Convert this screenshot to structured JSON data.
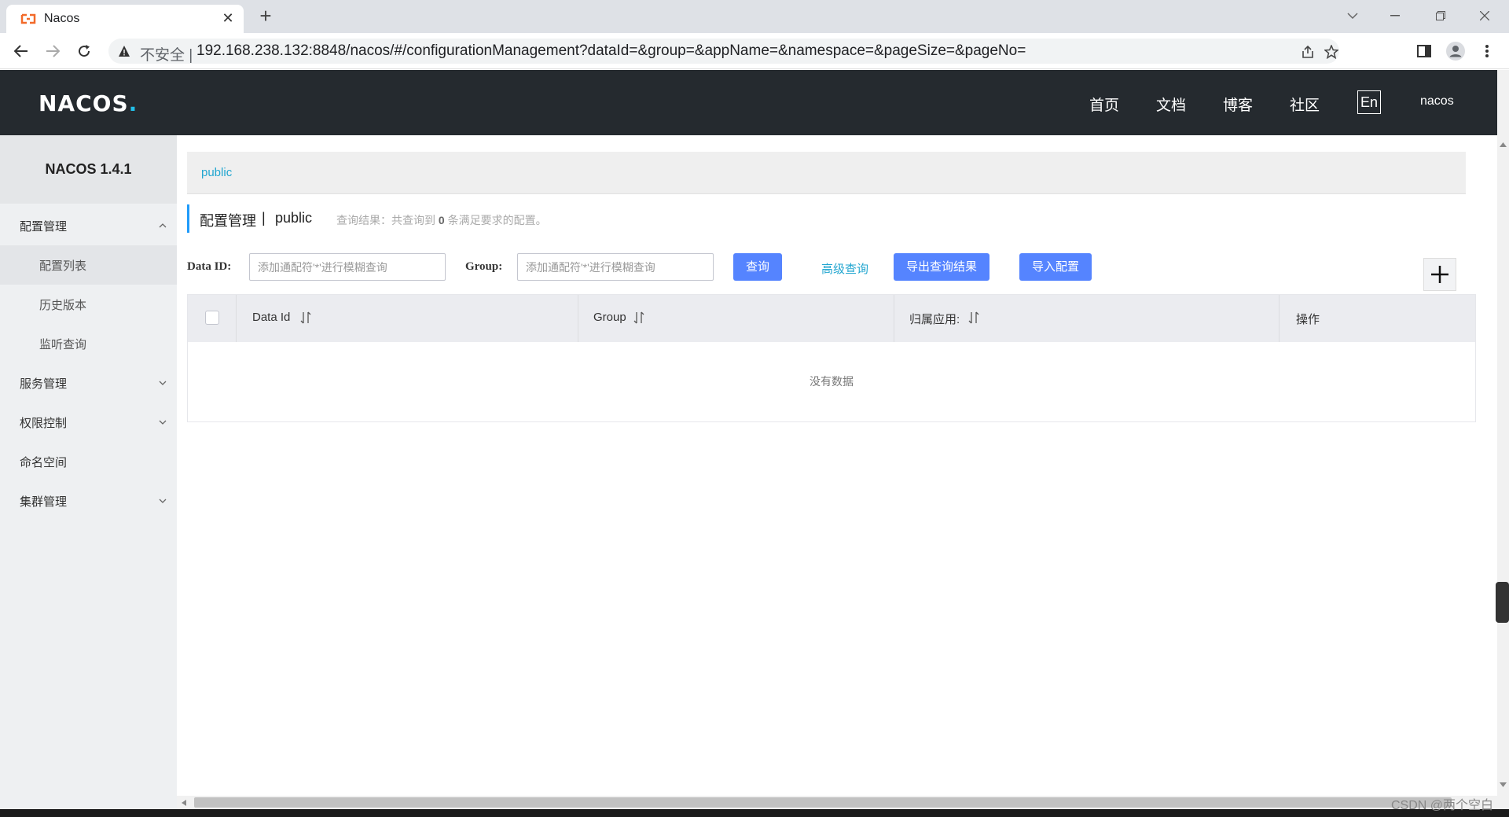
{
  "browser": {
    "tab_title": "Nacos",
    "security_label": "不安全 |",
    "url": "192.168.238.132:8848/nacos/#/configurationManagement?dataId=&group=&appName=&namespace=&pageSize=&pageNo="
  },
  "header": {
    "logo": "NACOS",
    "logo_dot": ".",
    "nav": [
      "首页",
      "文档",
      "博客",
      "社区"
    ],
    "lang": "En",
    "user": "nacos"
  },
  "sidebar": {
    "title": "NACOS 1.4.1",
    "items": [
      {
        "label": "配置管理"
      },
      {
        "label": "配置列表"
      },
      {
        "label": "历史版本"
      },
      {
        "label": "监听查询"
      },
      {
        "label": "服务管理"
      },
      {
        "label": "权限控制"
      },
      {
        "label": "命名空间"
      },
      {
        "label": "集群管理"
      }
    ]
  },
  "main": {
    "namespace_tab": "public",
    "page_title": "配置管理",
    "title_sep": "|",
    "namespace": "public",
    "result_prefix": "查询结果：共查询到",
    "result_count": "0",
    "result_suffix": "条满足要求的配置。",
    "filters": {
      "data_id_label": "Data ID:",
      "data_id_placeholder": "添加通配符'*'进行模糊查询",
      "group_label": "Group:",
      "group_placeholder": "添加通配符'*'进行模糊查询"
    },
    "buttons": {
      "query": "查询",
      "advanced": "高级查询",
      "export": "导出查询结果",
      "import": "导入配置",
      "add": "+"
    },
    "table": {
      "columns": [
        "Data Id",
        "Group",
        "归属应用:",
        "操作"
      ],
      "empty_text": "没有数据"
    }
  },
  "watermark": "CSDN @两个空白"
}
